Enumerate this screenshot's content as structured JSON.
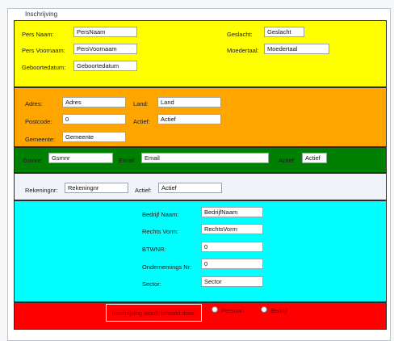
{
  "window": {
    "title": "Inschrijving"
  },
  "person": {
    "naam_label": "Pers Naam:",
    "naam_value": "PersNaam",
    "voornaam_label": "Pers Voornaam:",
    "voornaam_value": "PersVoornaam",
    "geboortedatum_label": "Geboortedatum:",
    "geboortedatum_value": "Geboortedatum",
    "geslacht_label": "Geslacht:",
    "geslacht_value": "Geslacht",
    "moedertaal_label": "Moedertaal:",
    "moedertaal_value": "Moedertaal"
  },
  "address": {
    "adres_label": "Adres:",
    "adres_value": "Adres",
    "postcode_label": "Postcode:",
    "postcode_value": "0",
    "gemeente_label": "Gemeente:",
    "gemeente_value": "Gemeente",
    "land_label": "Land:",
    "land_value": "Land",
    "actief_label": "Actief:",
    "actief_value": "Actief"
  },
  "contact": {
    "gsmnr_label": "Gsmnr:",
    "gsmnr_value": "Gsmnr",
    "email_label": "Email:",
    "email_value": "Email",
    "actief_label": "Actief:",
    "actief_value": "Actief"
  },
  "bank": {
    "rekeningnr_label": "Rekeningnr:",
    "rekeningnr_value": "Rekeningnr",
    "actief_label": "Actief:",
    "actief_value": "Actief"
  },
  "company": {
    "naam_label": "Bedrijf Naam:",
    "naam_value": "BedrijfNaam",
    "rechtsvorm_label": "Rechts Vorm:",
    "rechtsvorm_value": "RechtsVorm",
    "btwnr_label": "BTWNR:",
    "btwnr_value": "0",
    "ondernemingsnr_label": "Ondernemings Nr:",
    "ondernemingsnr_value": "0",
    "sector_label": "Sector:",
    "sector_value": "Sector"
  },
  "payment": {
    "checkbox_label": "Inschrijving wordt betaald door:",
    "option_persoon": "Persoon",
    "option_bedrijf": "Bedrijf"
  },
  "colors": {
    "person_panel": "#ffff00",
    "address_panel": "#ffa500",
    "contact_panel": "#008000",
    "bank_panel": "#f0f4fa",
    "company_panel": "#00ffff",
    "payment_panel": "#ff0000"
  }
}
